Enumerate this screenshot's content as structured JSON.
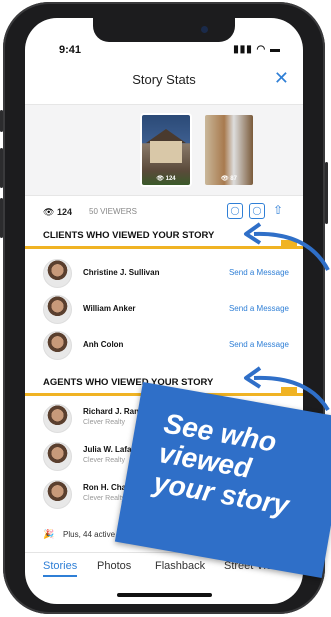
{
  "status": {
    "time": "9:41",
    "icons": "▮▮▮ ◠ ▬"
  },
  "header": {
    "title": "Story Stats",
    "close_glyph": "✕"
  },
  "thumbnails": [
    {
      "caption": "👁 124"
    },
    {
      "caption": "👁 87"
    }
  ],
  "viewers": {
    "count": "124",
    "viewers_label": "50 VIEWERS",
    "icons": [
      "instagram-icon",
      "instagram-icon",
      "share-icon"
    ]
  },
  "clients": {
    "heading": "CLIENTS WHO VIEWED YOUR STORY",
    "rows": [
      {
        "name": "Christine J. Sullivan",
        "action": "Send a Message"
      },
      {
        "name": "William Anker",
        "action": "Send a Message"
      },
      {
        "name": "Anh  Colon",
        "action": "Send a Message"
      }
    ]
  },
  "agents": {
    "heading": "AGENTS WHO VIEWED YOUR STORY",
    "rows": [
      {
        "name": "Richard J. Randa",
        "company": "Clever Realty"
      },
      {
        "name": "Julia W. Lafave",
        "company": "Clever Realty"
      },
      {
        "name": "Ron H. Charl",
        "company": "Clever Realty"
      }
    ]
  },
  "plus_text": "Plus, 44 active M",
  "tabs": [
    {
      "label": "Stories",
      "active": true
    },
    {
      "label": "Photos",
      "active": false
    },
    {
      "label": "Flashback",
      "active": false
    },
    {
      "label": "Street View",
      "active": false
    }
  ],
  "banner": {
    "line1": "See who",
    "line2": "viewed",
    "line3": "your story"
  },
  "colors": {
    "accent": "#2f7fd6",
    "highlight": "#f0b323",
    "banner": "#2f6fc8"
  }
}
